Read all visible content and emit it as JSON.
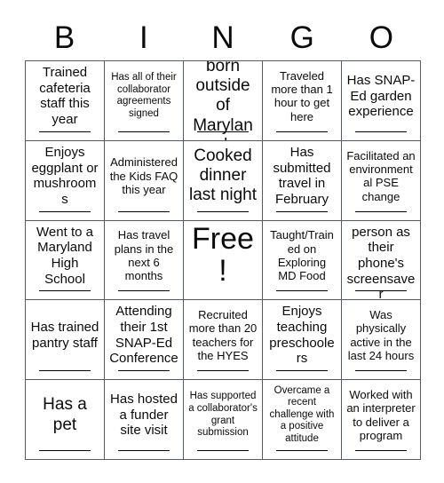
{
  "header": {
    "letters": [
      "B",
      "I",
      "N",
      "G",
      "O"
    ]
  },
  "card": {
    "title": "BINGO",
    "grid_size": 5,
    "free_space_label": "Free!",
    "free_space_position": "center",
    "colors": {
      "text": "#0b0b0b",
      "grid_line": "#555b5e",
      "signature_line": "#000000",
      "background": "#ffffff"
    },
    "cells": [
      {
        "text": "Trained cafeteria staff this year",
        "size": "md",
        "signature_line": true
      },
      {
        "text": "Has all of their collaborator agreements signed",
        "size": "xs",
        "signature_line": true
      },
      {
        "text": "Was born outside of Maryland",
        "size": "lg",
        "signature_line": true
      },
      {
        "text": "Traveled more than 1 hour to get here",
        "size": "sm",
        "signature_line": true
      },
      {
        "text": "Has SNAP-Ed garden experience",
        "size": "md",
        "signature_line": true
      },
      {
        "text": "Enjoys eggplant or mushrooms",
        "size": "md",
        "signature_line": true
      },
      {
        "text": "Administered the Kids FAQ this year",
        "size": "sm",
        "signature_line": true
      },
      {
        "text": "Cooked dinner last night",
        "size": "lg",
        "signature_line": true
      },
      {
        "text": "Has submitted travel in February",
        "size": "md",
        "signature_line": true
      },
      {
        "text": "Facilitated an environmental PSE change",
        "size": "sm",
        "signature_line": true
      },
      {
        "text": "Went to a Maryland High School",
        "size": "md",
        "signature_line": true
      },
      {
        "text": "Has travel plans in the next 6 months",
        "size": "sm",
        "signature_line": true
      },
      {
        "text": "Free!",
        "size": "xl",
        "signature_line": false
      },
      {
        "text": "Taught/Trained on Exploring MD Food",
        "size": "sm",
        "signature_line": true
      },
      {
        "text": "Has a person as their phone's screensaver",
        "size": "md",
        "signature_line": true
      },
      {
        "text": "Has trained pantry staff",
        "size": "md",
        "signature_line": true
      },
      {
        "text": "Attending their 1st SNAP-Ed Conference",
        "size": "md",
        "signature_line": true
      },
      {
        "text": "Recruited more than 20 teachers for the HYES",
        "size": "sm",
        "signature_line": true
      },
      {
        "text": "Enjoys teaching preschoolers",
        "size": "md",
        "signature_line": true
      },
      {
        "text": "Was physically active in the last 24 hours",
        "size": "sm",
        "signature_line": true
      },
      {
        "text": "Has a pet",
        "size": "lg",
        "signature_line": true
      },
      {
        "text": "Has hosted a funder site visit",
        "size": "md",
        "signature_line": true
      },
      {
        "text": "Has supported a collaborator's grant submission",
        "size": "xs",
        "signature_line": true
      },
      {
        "text": "Overcame a recent challenge with a positive attitude",
        "size": "xs",
        "signature_line": true
      },
      {
        "text": "Worked with an interpreter to deliver a program",
        "size": "sm",
        "signature_line": true
      }
    ]
  }
}
